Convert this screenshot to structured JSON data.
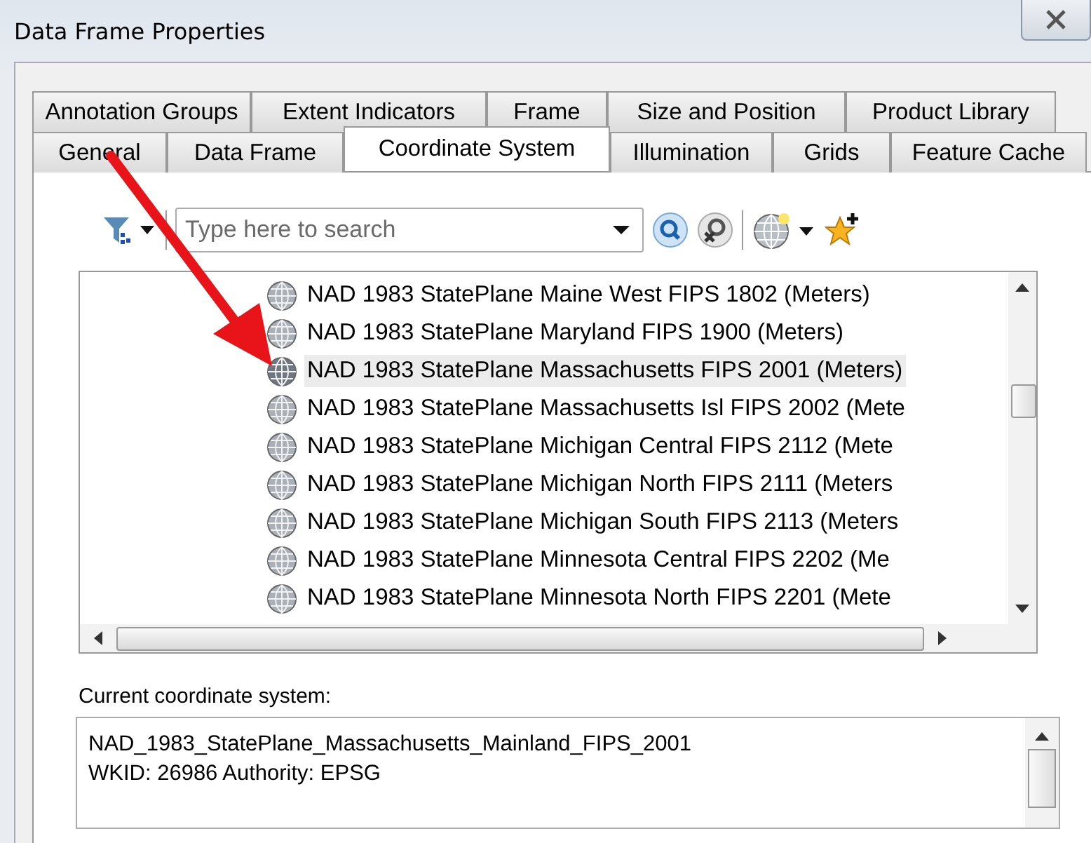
{
  "window": {
    "title": "Data Frame Properties"
  },
  "tab_rows": [
    [
      {
        "label": "Annotation Groups",
        "selected": false
      },
      {
        "label": "Extent Indicators",
        "selected": false
      },
      {
        "label": "Frame",
        "selected": false
      },
      {
        "label": "Size and Position",
        "selected": false
      },
      {
        "label": "Product Library",
        "selected": false
      }
    ],
    [
      {
        "label": "General",
        "selected": false
      },
      {
        "label": "Data Frame",
        "selected": false
      },
      {
        "label": "Coordinate System",
        "selected": true
      },
      {
        "label": "Illumination",
        "selected": false
      },
      {
        "label": "Grids",
        "selected": false
      },
      {
        "label": "Feature Cache",
        "selected": false
      }
    ]
  ],
  "search": {
    "placeholder": "Type here to search"
  },
  "list": [
    {
      "label": "NAD 1983 StatePlane Maine West FIPS 1802 (Meters)",
      "selected": false
    },
    {
      "label": "NAD 1983 StatePlane Maryland FIPS 1900 (Meters)",
      "selected": false
    },
    {
      "label": "NAD 1983 StatePlane Massachusetts FIPS 2001 (Meters)",
      "selected": true
    },
    {
      "label": "NAD 1983 StatePlane Massachusetts Isl FIPS 2002 (Mete",
      "selected": false
    },
    {
      "label": "NAD 1983 StatePlane Michigan Central FIPS 2112 (Mete",
      "selected": false
    },
    {
      "label": "NAD 1983 StatePlane Michigan North FIPS 2111 (Meters",
      "selected": false
    },
    {
      "label": "NAD 1983 StatePlane Michigan South FIPS 2113 (Meters",
      "selected": false
    },
    {
      "label": "NAD 1983 StatePlane Minnesota Central FIPS 2202 (Me",
      "selected": false
    },
    {
      "label": "NAD 1983 StatePlane Minnesota North FIPS 2201 (Mete",
      "selected": false
    }
  ],
  "current": {
    "label": "Current coordinate system:",
    "lines": [
      "NAD_1983_StatePlane_Massachusetts_Mainland_FIPS_2001",
      "WKID: 26986 Authority: EPSG"
    ]
  }
}
